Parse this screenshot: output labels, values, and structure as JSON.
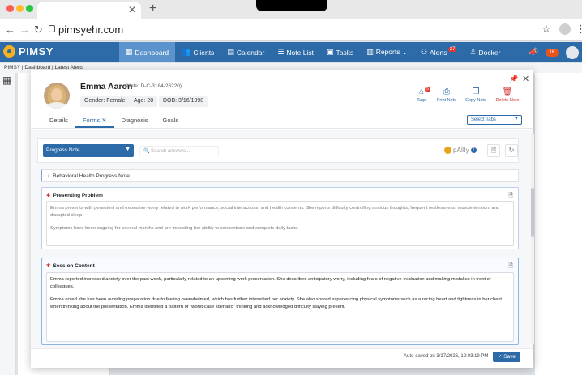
{
  "browser": {
    "url": "pimsyehr.com",
    "new_tab": "+"
  },
  "app": {
    "logo": "PIMSY",
    "nav": [
      {
        "icon": "▦",
        "label": "Dashboard"
      },
      {
        "icon": "👥",
        "label": "Clients"
      },
      {
        "icon": "▤",
        "label": "Calendar"
      },
      {
        "icon": "☰",
        "label": "Note List"
      },
      {
        "icon": "▣",
        "label": "Tasks"
      },
      {
        "icon": "▥",
        "label": "Reports ⌄"
      },
      {
        "icon": "⚇",
        "label": "Alerts",
        "badge": "27"
      },
      {
        "icon": "⚓",
        "label": "Docker"
      }
    ],
    "notif_count": "1K"
  },
  "breadcrumb": "PIMSY | Dashboard | Latest Alerts",
  "patient": {
    "name": "Emma Aaron",
    "note": "(Note: D-C-3184-26220)",
    "gender": "Gender: Female",
    "age": "Age: 28",
    "dob": "DOB: 3/16/1998"
  },
  "actions": {
    "tags": "Tags",
    "tags_count": "5",
    "print": "Print Note",
    "copy": "Copy Note",
    "delete": "Delete Note"
  },
  "tabs": [
    "Details",
    "Forms",
    "Diagnosis",
    "Goals"
  ],
  "select_tabs": "Select Tabs",
  "form": {
    "note_type": "Progress Note",
    "search_placeholder": "Search answers...",
    "pally": "pAIlly",
    "section": "Behavioral Health Progress Note",
    "presenting_title": "Presenting Problem",
    "presenting_p1": "Emma presents with persistent and excessive worry related to work performance, social interactions, and health concerns. She reports difficulty controlling anxious thoughts, frequent restlessness, muscle tension, and disrupted sleep.",
    "presenting_p2": "Symptoms have been ongoing for several months and are impacting her ability to concentrate and complete daily tasks.",
    "session_title": "Session Content",
    "session_p1": "Emma reported increased anxiety over the past week, particularly related to an upcoming work presentation. She described anticipatory worry, including fears of negative evaluation and making mistakes in front of colleagues.",
    "session_p2": "Emma noted she has been avoiding preparation due to feeling overwhelmed, which has further intensified her anxiety. She also shared experiencing physical symptoms such as a racing heart and tightness in her chest when thinking about the presentation. Emma identified a pattern of \"worst-case scenario\" thinking and acknowledged difficulty staying present."
  },
  "footer": {
    "autosave": "Auto-saved on 3/17/2026, 12:03:19 PM",
    "save": "Save"
  },
  "colors": {
    "primary": "#2d6aa8",
    "danger": "#d32f2f",
    "logo": "#f5b21c"
  }
}
